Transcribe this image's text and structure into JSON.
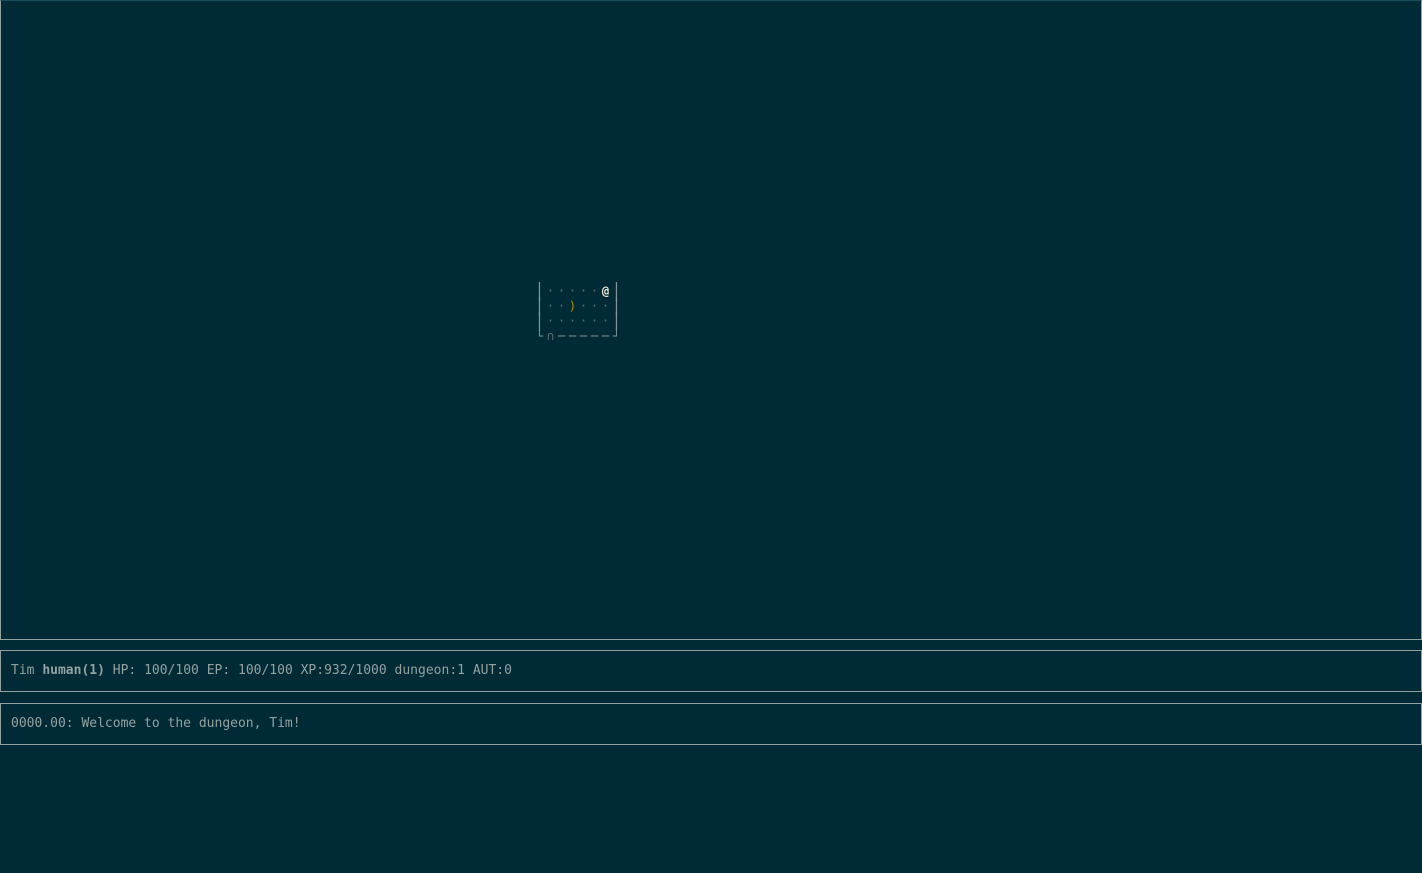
{
  "map": {
    "rows": [
      [
        "│",
        "·",
        "·",
        "·",
        "·",
        "·",
        "@",
        "│"
      ],
      [
        "│",
        "·",
        "·",
        ")",
        "·",
        "·",
        "·",
        "│"
      ],
      [
        "│",
        "·",
        "·",
        "·",
        "·",
        "·",
        "·",
        "│"
      ],
      [
        "└",
        "∩",
        "─",
        "─",
        "─",
        "─",
        "─",
        "┘"
      ]
    ],
    "colors": {
      "background": "#002b36",
      "wall": "#839496",
      "floor": "#586e75",
      "weapon": "#b58900",
      "player": "#eee8d5"
    }
  },
  "status": {
    "name": "Tim",
    "race_level": "human(1)",
    "hp": "HP: 100/100",
    "ep": "EP: 100/100",
    "xp": "XP:932/1000",
    "location": "dungeon:1",
    "aut": "AUT:0"
  },
  "messages": [
    "0000.00: Welcome to the dungeon, Tim!"
  ]
}
